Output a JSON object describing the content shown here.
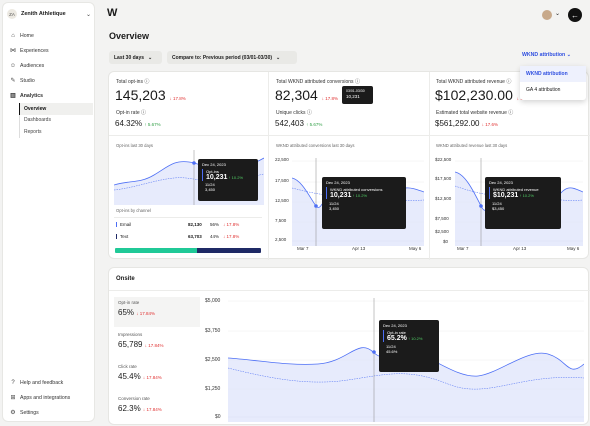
{
  "sidebar": {
    "org_initials": "ZA",
    "org_name": "Zenith Athletique",
    "items": [
      {
        "label": "Home",
        "icon": "home-icon"
      },
      {
        "label": "Experiences",
        "icon": "experiences-icon"
      },
      {
        "label": "Audiences",
        "icon": "audiences-icon"
      },
      {
        "label": "Studio",
        "icon": "studio-icon"
      },
      {
        "label": "Analytics",
        "icon": "analytics-icon"
      }
    ],
    "sub_items": [
      {
        "label": "Overview"
      },
      {
        "label": "Dashboards"
      },
      {
        "label": "Reports"
      }
    ],
    "bottom_items": [
      {
        "label": "Help and feedback",
        "icon": "help-icon"
      },
      {
        "label": "Apps and integrations",
        "icon": "apps-icon"
      },
      {
        "label": "Settings",
        "icon": "settings-icon"
      }
    ]
  },
  "header": {
    "title": "Overview",
    "date_filter": "Last 30 days",
    "compare_filter": "Compare to: Previous period (03/01-03/30)",
    "attribution_select": "WKND attribution",
    "attribution_options": [
      "WKND attribution",
      "GA 4 attribution"
    ]
  },
  "colors": {
    "accent": "#2f4fe0",
    "positive": "#2f9e44",
    "negative": "#e03131",
    "chart_fill": "#dde3fb"
  },
  "overview": {
    "col1": {
      "label": "Total opt-ins",
      "value": "145,203",
      "delta": "17.8%",
      "sub_label": "Opt-in rate",
      "sub_value": "64.32%",
      "sub_delta": "5.67%",
      "chart_title": "Opt-ins last 30 days",
      "tooltip": {
        "date": "Dec 24, 2023",
        "metric": "Opt-ins",
        "value": "10,231",
        "delta": "10.2%",
        "compare_date": "11/24",
        "compare_value": "3,450"
      },
      "channel_title": "Opt-ins by channel",
      "channels": [
        {
          "name": "Email",
          "value": "82,130",
          "pct": "56%",
          "delta": "17.8%"
        },
        {
          "name": "Text",
          "value": "63,703",
          "pct": "44%",
          "delta": "17.8%"
        }
      ]
    },
    "col2": {
      "label": "Total WKND attributed conversions",
      "value": "82,304",
      "delta": "17.8%",
      "sub_label": "Unique clicks",
      "sub_value": "542,403",
      "sub_delta": "5.67%",
      "chart_title": "WKND attributed conversions last 30 days",
      "mini_tooltip": {
        "range": "03/01-03/30",
        "value": "10,231"
      },
      "y_ticks": [
        "22,500",
        "17,500",
        "12,500",
        "7,500",
        "2,500"
      ],
      "x_ticks": [
        "Mar 7",
        "Apr 13",
        "May 6"
      ],
      "tooltip": {
        "date": "Dec 24, 2023",
        "metric": "WKND attributed conversions",
        "value": "10,231",
        "delta": "10.2%",
        "compare_date": "11/24",
        "compare_value": "3,450"
      }
    },
    "col3": {
      "label": "Total WKND attributed revenue",
      "value": "$102,230.00",
      "delta": "17.8%",
      "sub_label": "Estimated total website revenue",
      "sub_value": "$561,292.00",
      "sub_delta": "17.6%",
      "chart_title": "WKND attributed revenue last 30 days",
      "y_ticks": [
        "$22,500",
        "$17,500",
        "$12,500",
        "$7,500",
        "$2,500",
        "$0"
      ],
      "x_ticks": [
        "Mar 7",
        "Apr 13",
        "May 6"
      ],
      "tooltip": {
        "date": "Dec 24, 2023",
        "metric": "WKND attributed revenue",
        "value": "$10,231",
        "delta": "10.2%",
        "compare_date": "11/24",
        "compare_value": "$3,450"
      }
    }
  },
  "onsite": {
    "title": "Onsite",
    "metrics": [
      {
        "label": "Opt-in rate",
        "value": "65%",
        "delta": "17.84%"
      },
      {
        "label": "Impressions",
        "value": "65,789",
        "delta": "17.84%"
      },
      {
        "label": "Click rate",
        "value": "45.4%",
        "delta": "17.84%"
      },
      {
        "label": "Conversion rate",
        "value": "62.3%",
        "delta": "17.84%"
      }
    ],
    "y_ticks": [
      "$5,000",
      "$3,750",
      "$2,500",
      "$1,250",
      "$0"
    ],
    "tooltip": {
      "date": "Dec 24, 2023",
      "metric": "Opt-in rate",
      "value": "65.2%",
      "delta": "10.2%",
      "compare_date": "11/24",
      "compare_value": "45.6%"
    }
  }
}
